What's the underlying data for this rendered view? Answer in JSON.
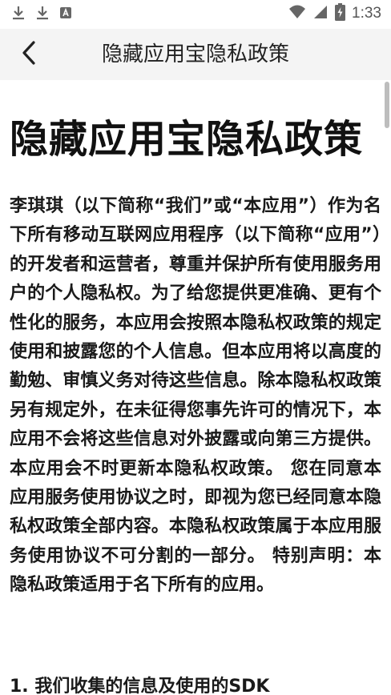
{
  "status_bar": {
    "time": "1:33",
    "icons": [
      "download-icon",
      "download-icon",
      "app-notification-icon",
      "wifi-icon",
      "cellular-signal-icon",
      "battery-charging-icon"
    ]
  },
  "app_bar": {
    "title": "隐藏应用宝隐私政策",
    "back_icon": "chevron-left-icon"
  },
  "document": {
    "title": "隐藏应用宝隐私政策",
    "body": "李琪琪（以下简称“我们”或“本应用”）作为名下所有移动互联网应用程序（以下简称“应用”）的开发者和运营者，尊重并保护所有使用服务用户的个人隐私权。为了给您提供更准确、更有个性化的服务，本应用会按照本隐私权政策的规定使用和披露您的个人信息。但本应用将以高度的勤勉、审慎义务对待这些信息。除本隐私权政策另有规定外，在未征得您事先许可的情况下，本应用不会将这些信息对外披露或向第三方提供。本应用会不时更新本隐私权政策。 您在同意本应用服务使用协议之时，即视为您已经同意本隐私权政策全部内容。本隐私权政策属于本应用服务使用协议不可分割的一部分。 特别声明：本隐私政策适用于名下所有的应用。",
    "section_1_heading": "1. 我们收集的信息及使用的SDK"
  }
}
